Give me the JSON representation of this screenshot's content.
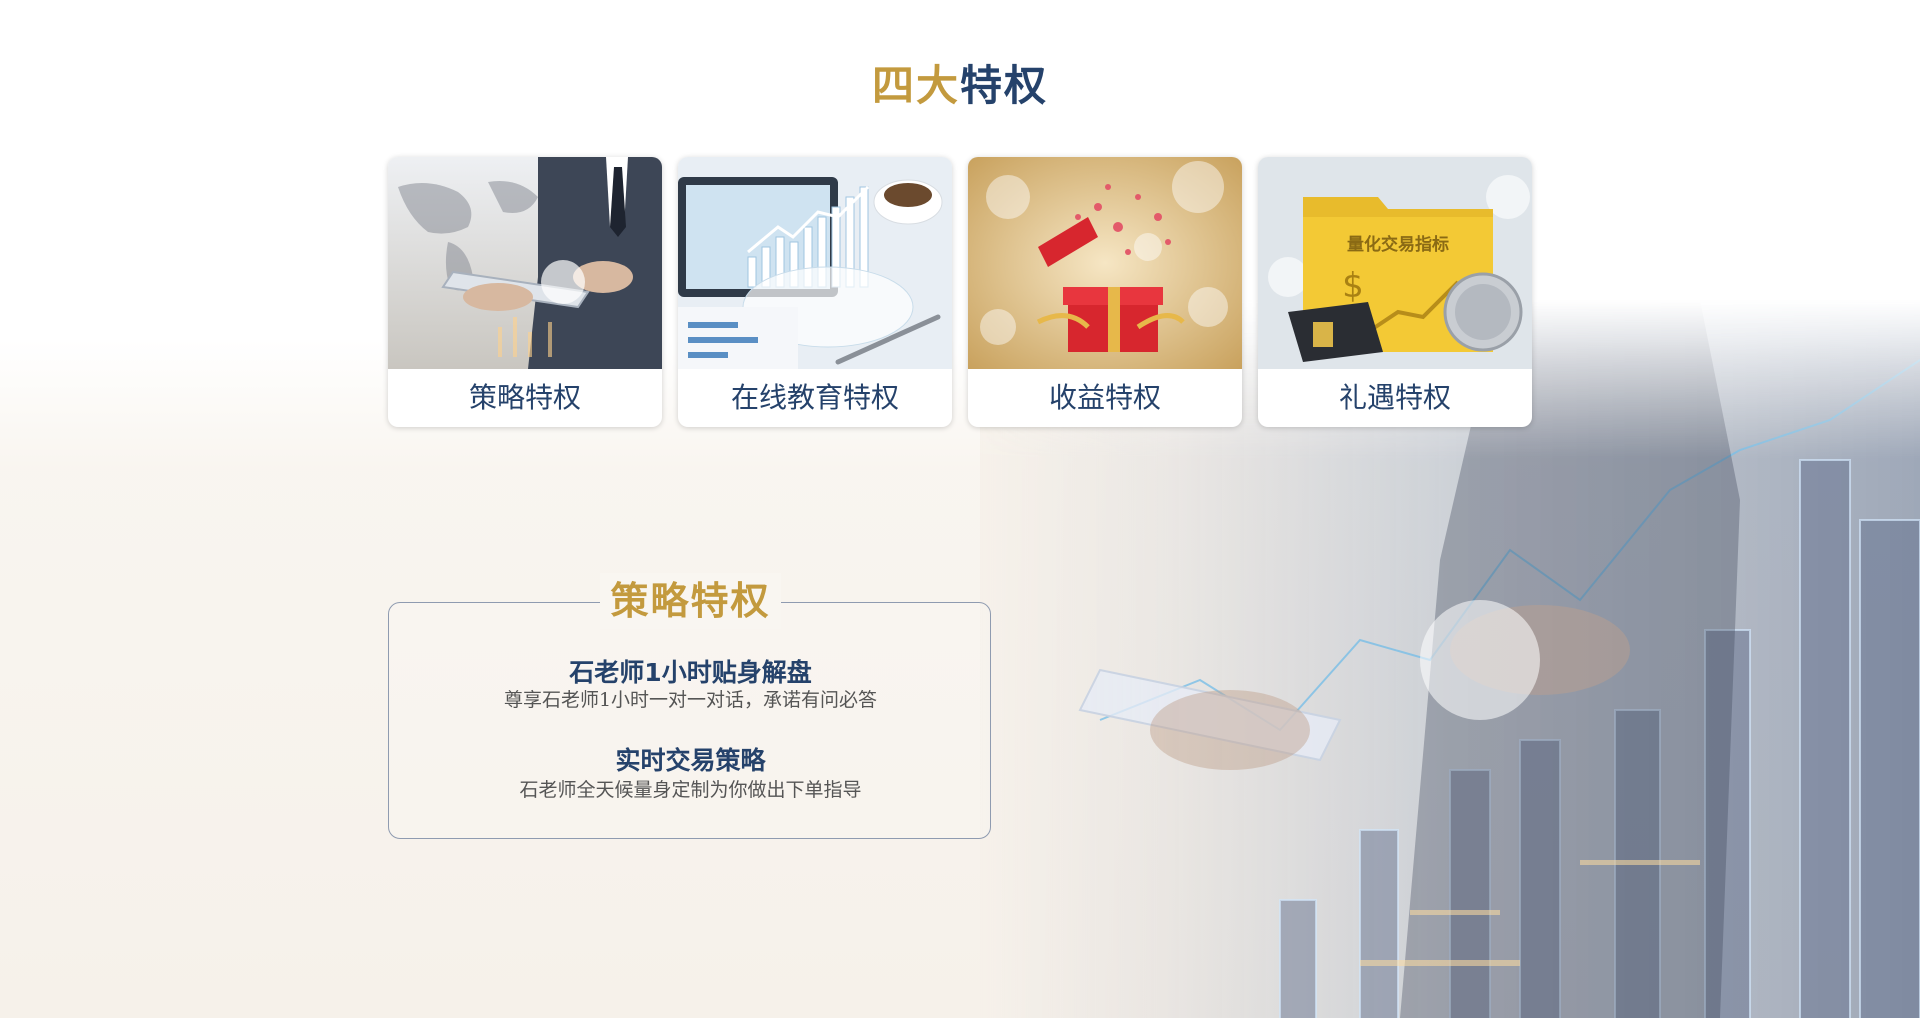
{
  "heading": {
    "part1": "四大",
    "part2": "特权"
  },
  "cards": [
    {
      "label": "策略特权"
    },
    {
      "label": "在线教育特权"
    },
    {
      "label": "收益特权"
    },
    {
      "label": "礼遇特权",
      "image_text": "量化交易指标"
    }
  ],
  "panel": {
    "title": "策略特权",
    "items": [
      {
        "title": "石老师1小时贴身解盘",
        "desc": "尊享石老师1小时一对一对话，承诺有问必答"
      },
      {
        "title": "实时交易策略",
        "desc": "石老师全天候量身定制为你做出下单指导"
      }
    ]
  },
  "colors": {
    "gold": "#c39a3e",
    "navy": "#25426b",
    "border": "#8f9bb0"
  }
}
